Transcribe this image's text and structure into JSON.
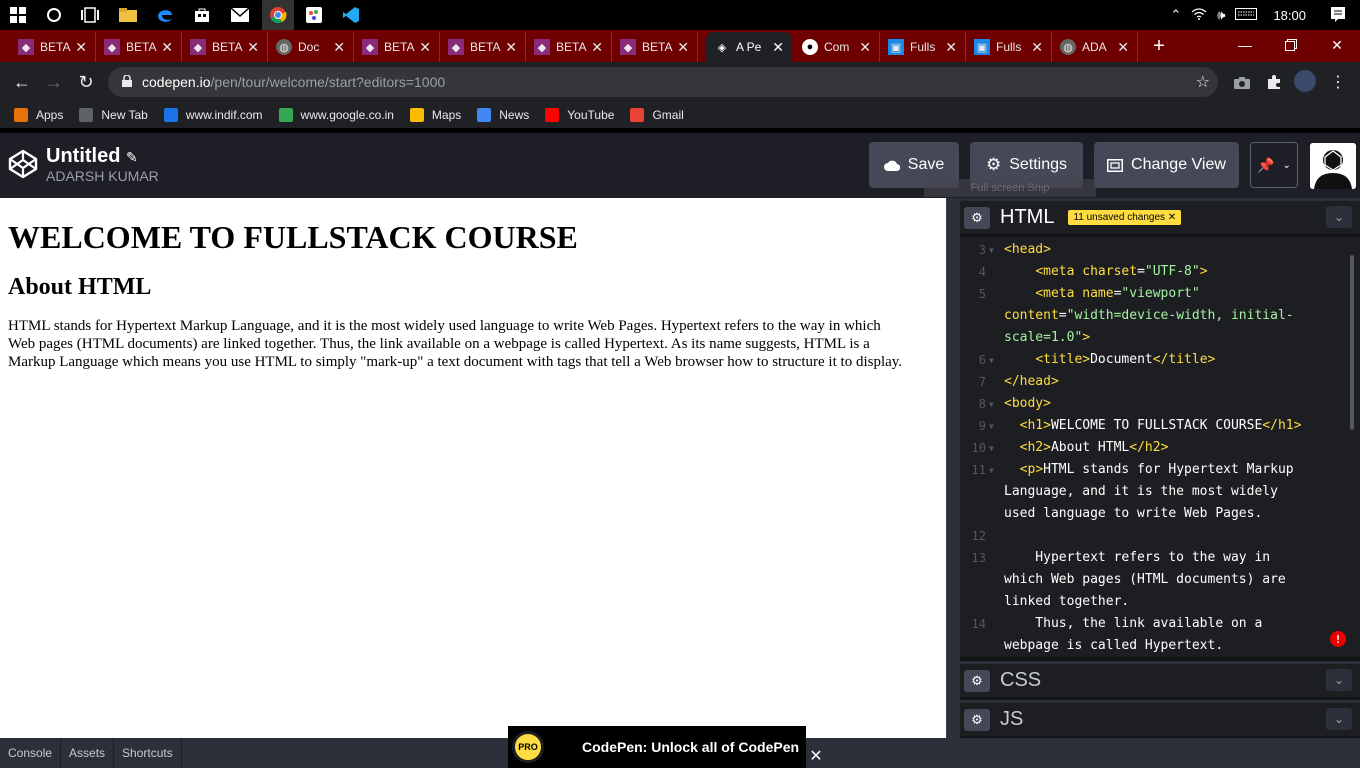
{
  "taskbar": {
    "time": "18:00",
    "icons": [
      "windows-start-icon",
      "cortana-icon",
      "task-view-icon",
      "file-explorer-icon",
      "edge-icon",
      "store-icon",
      "mail-icon",
      "chrome-icon",
      "paint-icon",
      "vscode-icon"
    ]
  },
  "tabs": [
    {
      "title": "BETA",
      "icon": "beta-favicon"
    },
    {
      "title": "BETA",
      "icon": "beta-favicon"
    },
    {
      "title": "BETA",
      "icon": "beta-favicon"
    },
    {
      "title": "Doc",
      "icon": "globe-favicon"
    },
    {
      "title": "BETA",
      "icon": "beta-favicon"
    },
    {
      "title": "BETA",
      "icon": "beta-favicon"
    },
    {
      "title": "BETA",
      "icon": "beta-favicon"
    },
    {
      "title": "BETA",
      "icon": "beta-favicon"
    },
    {
      "title": "A Pe",
      "icon": "codepen-favicon"
    },
    {
      "title": "Com",
      "icon": "github-favicon"
    },
    {
      "title": "Fulls",
      "icon": "classroom-favicon"
    },
    {
      "title": "Fulls",
      "icon": "classroom-favicon"
    },
    {
      "title": "ADA",
      "icon": "globe-favicon"
    }
  ],
  "address": {
    "host": "codepen.io",
    "path": "/pen/tour/welcome/start?editors=1000"
  },
  "bookmarks": [
    {
      "label": "Apps",
      "color": "#e8710a"
    },
    {
      "label": "New Tab",
      "color": "#5f6368"
    },
    {
      "label": "www.indif.com",
      "color": "#1a73e8"
    },
    {
      "label": "www.google.co.in",
      "color": "#34a853"
    },
    {
      "label": "Maps",
      "color": "#fbbc04"
    },
    {
      "label": "News",
      "color": "#4285f4"
    },
    {
      "label": "YouTube",
      "color": "#ff0000"
    },
    {
      "label": "Gmail",
      "color": "#ea4335"
    }
  ],
  "pen": {
    "title": "Untitled",
    "author": "ADARSH KUMAR"
  },
  "header_buttons": {
    "save": "Save",
    "settings": "Settings",
    "change_view": "Change View"
  },
  "tooltip": "Full screen Snip",
  "preview": {
    "h1": "WELCOME TO FULLSTACK COURSE",
    "h2": "About HTML",
    "p": "HTML stands for Hypertext Markup Language, and it is the most widely used language to write Web Pages. Hypertext refers to the way in which Web pages (HTML documents) are linked together. Thus, the link available on a webpage is called Hypertext. As its name suggests, HTML is a Markup Language which means you use HTML to simply \"mark-up\" a text document with tags that tell a Web browser how to structure it to display."
  },
  "editors": {
    "html_label": "HTML",
    "badge": "11 unsaved changes",
    "css_label": "CSS",
    "js_label": "JS"
  },
  "code_lines": [
    {
      "num": "3",
      "fold": true,
      "text": "<head>"
    },
    {
      "num": "4",
      "fold": false,
      "text": "    <meta charset=\"UTF-8\">"
    },
    {
      "num": "5",
      "fold": false,
      "text": "    <meta name=\"viewport\""
    },
    {
      "num": "",
      "fold": false,
      "text": "content=\"width=device-width, initial-"
    },
    {
      "num": "",
      "fold": false,
      "text": "scale=1.0\">"
    },
    {
      "num": "6",
      "fold": true,
      "text": "    <title>Document</title>"
    },
    {
      "num": "7",
      "fold": false,
      "text": "</head>"
    },
    {
      "num": "8",
      "fold": true,
      "text": "<body>"
    },
    {
      "num": "9",
      "fold": true,
      "text": "  <h1>WELCOME TO FULLSTACK COURSE</h1>"
    },
    {
      "num": "10",
      "fold": true,
      "text": "  <h2>About HTML</h2>"
    },
    {
      "num": "11",
      "fold": true,
      "text": "  <p>HTML stands for Hypertext Markup"
    },
    {
      "num": "",
      "fold": false,
      "text": "Language, and it is the most widely"
    },
    {
      "num": "",
      "fold": false,
      "text": "used language to write Web Pages."
    },
    {
      "num": "12",
      "fold": false,
      "text": ""
    },
    {
      "num": "13",
      "fold": false,
      "text": "    Hypertext refers to the way in"
    },
    {
      "num": "",
      "fold": false,
      "text": "which Web pages (HTML documents) are"
    },
    {
      "num": "",
      "fold": false,
      "text": "linked together."
    },
    {
      "num": "14",
      "fold": false,
      "text": "    Thus, the link available on a"
    },
    {
      "num": "",
      "fold": false,
      "text": "webpage is called Hypertext."
    }
  ],
  "footer": {
    "console": "Console",
    "assets": "Assets",
    "shortcuts": "Shortcuts"
  },
  "promo": {
    "pro": "PRO",
    "text": "CodePen: Unlock all of CodePen"
  },
  "colors": {
    "tabbar": "#6f0000",
    "codepen_dark": "#1e1f26",
    "badge": "#ffdd40"
  }
}
